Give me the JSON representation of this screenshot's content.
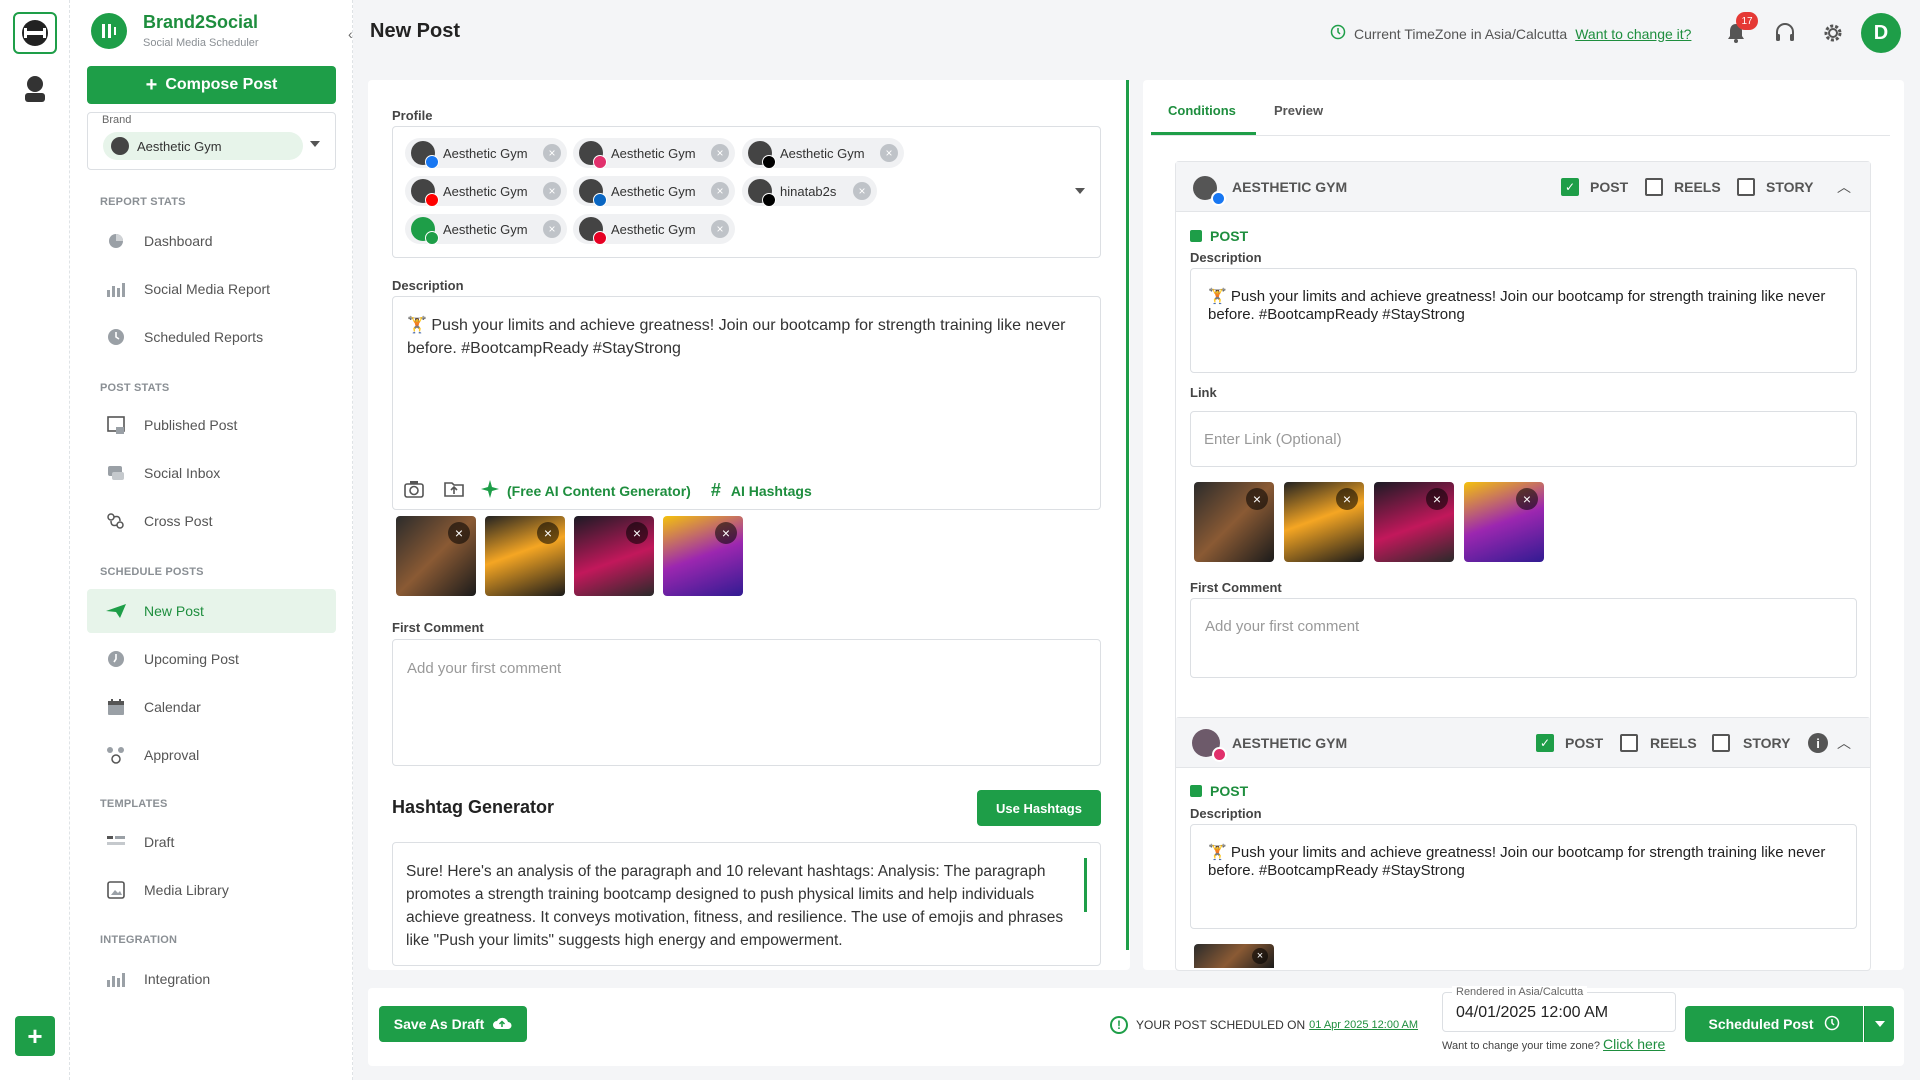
{
  "colors": {
    "accent": "#1e9e48",
    "badge": "#e53935"
  },
  "app": {
    "name": "Brand2Social",
    "subtitle": "Social Media Scheduler"
  },
  "sidebar": {
    "compose_label": "Compose Post",
    "brand_label": "Brand",
    "brand_value": "Aesthetic Gym",
    "sections": {
      "report": "REPORT STATS",
      "post": "POST STATS",
      "schedule": "SCHEDULE POSTS",
      "templates": "TEMPLATES",
      "integration": "INTEGRATION"
    },
    "items": [
      {
        "label": "Dashboard",
        "icon": "pie-chart-icon"
      },
      {
        "label": "Social Media Report",
        "icon": "bar-chart-icon"
      },
      {
        "label": "Scheduled Reports",
        "icon": "clock-report-icon"
      },
      {
        "label": "Published Post",
        "icon": "published-icon"
      },
      {
        "label": "Social Inbox",
        "icon": "inbox-icon"
      },
      {
        "label": "Cross Post",
        "icon": "cross-post-icon"
      },
      {
        "label": "New Post",
        "icon": "new-post-icon"
      },
      {
        "label": "Upcoming Post",
        "icon": "clock-icon"
      },
      {
        "label": "Calendar",
        "icon": "calendar-icon"
      },
      {
        "label": "Approval",
        "icon": "approval-icon"
      },
      {
        "label": "Draft",
        "icon": "draft-icon"
      },
      {
        "label": "Media Library",
        "icon": "media-library-icon"
      },
      {
        "label": "Integration",
        "icon": "integration-icon"
      }
    ]
  },
  "header": {
    "title": "New Post",
    "timezone_text": "Current TimeZone in Asia/Calcutta",
    "timezone_link": "Want to change it?",
    "notification_count": "17",
    "avatar_letter": "D"
  },
  "left": {
    "profile_label": "Profile",
    "profiles": [
      {
        "name": "Aesthetic Gym",
        "network": "facebook",
        "color": "#1877f2"
      },
      {
        "name": "Aesthetic Gym",
        "network": "instagram",
        "color": "#e1306c"
      },
      {
        "name": "Aesthetic Gym",
        "network": "x",
        "color": "#000000"
      },
      {
        "name": "Aesthetic Gym",
        "network": "youtube",
        "color": "#ff0000"
      },
      {
        "name": "Aesthetic Gym",
        "network": "linkedin",
        "color": "#0a66c2"
      },
      {
        "name": "hinatab2s",
        "network": "tiktok",
        "color": "#000000"
      },
      {
        "name": "Aesthetic Gym",
        "network": "google-business",
        "color": "#1e9e48"
      },
      {
        "name": "Aesthetic Gym",
        "network": "pinterest",
        "color": "#e60023"
      }
    ],
    "description_label": "Description",
    "description_text": "🏋 Push your limits and achieve greatness! Join our bootcamp for strength training like never before. #BootcampReady #StayStrong",
    "ai_content_label": "(Free AI Content Generator)",
    "ai_hashtags_label": "AI Hashtags",
    "first_comment_label": "First Comment",
    "first_comment_placeholder": "Add your first comment",
    "hashtag_title": "Hashtag Generator",
    "use_hashtags_label": "Use Hashtags",
    "hashtag_output": "Sure! Here's an analysis of the paragraph and 10 relevant hashtags:  Analysis: The paragraph promotes a strength training bootcamp designed to push physical limits and help individuals achieve greatness. It conveys motivation, fitness, and resilience. The use of emojis and phrases like \"Push your limits\" suggests high energy and empowerment."
  },
  "right": {
    "tabs": [
      "Conditions",
      "Preview"
    ],
    "card1": {
      "name": "AESTHETIC GYM",
      "opt_post": "POST",
      "opt_reels": "REELS",
      "opt_story": "STORY",
      "section": "POST",
      "description_label": "Description",
      "description_text": "🏋 Push your limits and achieve greatness! Join our bootcamp for strength training like never before. #BootcampReady #StayStrong",
      "link_label": "Link",
      "link_placeholder": "Enter Link (Optional)",
      "first_comment_label": "First Comment",
      "first_comment_placeholder": "Add your first comment"
    },
    "card2": {
      "name": "AESTHETIC GYM",
      "opt_post": "POST",
      "opt_reels": "REELS",
      "opt_story": "STORY",
      "section": "POST",
      "description_label": "Description",
      "description_text": "🏋 Push your limits and achieve greatness! Join our bootcamp for strength training like never before. #BootcampReady #StayStrong"
    }
  },
  "footer": {
    "draft_label": "Save As Draft",
    "scheduled_on": "YOUR POST SCHEDULED ON",
    "scheduled_link": "01 Apr 2025 12:00 AM",
    "rendered_label": "Rendered in Asia/Calcutta",
    "datetime": "04/01/2025 12:00 AM",
    "tz_question": "Want to change your time zone?",
    "tz_link": "Click here",
    "scheduled_btn": "Scheduled Post"
  }
}
